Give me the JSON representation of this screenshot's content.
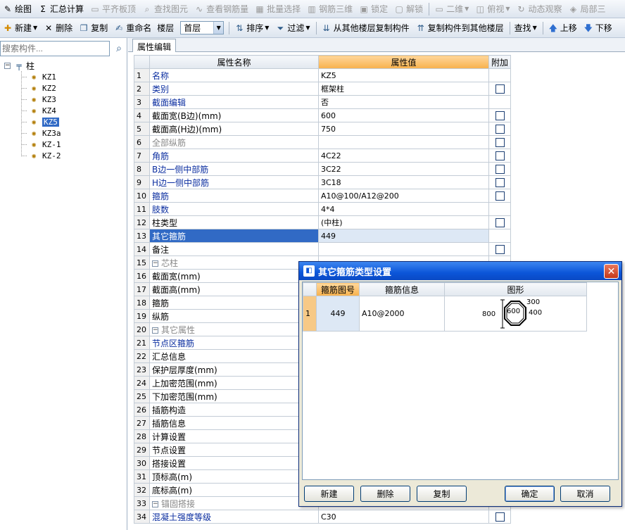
{
  "toolbar1": [
    {
      "label": "绘图",
      "icon": "draw-icon",
      "glyph": "✎",
      "disabled": false
    },
    {
      "label": "汇总计算",
      "icon": "sigma-icon",
      "glyph": "Σ",
      "disabled": false
    },
    {
      "label": "平齐板顶",
      "icon": "align-slab-top-icon",
      "glyph": "▭",
      "disabled": true
    },
    {
      "label": "查找图元",
      "icon": "find-element-icon",
      "glyph": "⌕",
      "disabled": true
    },
    {
      "label": "查看钢筋量",
      "icon": "view-rebar-icon",
      "glyph": "∿",
      "disabled": true
    },
    {
      "label": "批量选择",
      "icon": "batch-select-icon",
      "glyph": "▦",
      "disabled": true
    },
    {
      "label": "钢筋三维",
      "icon": "rebar-3d-icon",
      "glyph": "▥",
      "disabled": true
    },
    {
      "label": "锁定",
      "icon": "lock-icon",
      "glyph": "▣",
      "disabled": true
    },
    {
      "label": "解锁",
      "icon": "unlock-icon",
      "glyph": "▢",
      "disabled": true
    },
    {
      "label": "二维",
      "icon": "2d-view-icon",
      "glyph": "▭",
      "disabled": true
    },
    {
      "label": "俯视",
      "icon": "top-view-icon",
      "glyph": "◫",
      "disabled": true
    },
    {
      "label": "动态观察",
      "icon": "orbit-icon",
      "glyph": "↻",
      "disabled": true
    },
    {
      "label": "局部三",
      "icon": "local-3d-icon",
      "glyph": "◈",
      "disabled": true
    }
  ],
  "toolbar2": {
    "new": "新建",
    "delete": "删除",
    "copy": "复制",
    "rename": "重命名",
    "floor_label": "楼层",
    "floor_value": "首层",
    "sort": "排序",
    "filter": "过滤",
    "copy_from": "从其他楼层复制构件",
    "copy_to": "复制构件到其他楼层",
    "find": "查找",
    "move_up": "上移",
    "move_down": "下移"
  },
  "sidebar": {
    "search_placeholder": "搜索构件...",
    "root": "柱",
    "items": [
      "KZ1",
      "KZ2",
      "KZ3",
      "KZ4",
      "KZ5",
      "KZ3a",
      "KZ-1",
      "KZ-2"
    ],
    "selected_index": 4
  },
  "main": {
    "tab": "属性编辑",
    "headers": {
      "name": "属性名称",
      "value": "属性值",
      "extra": "附加"
    },
    "rows": [
      {
        "n": "1",
        "name": "名称",
        "value": "KZ5",
        "style": "blue",
        "cb": false,
        "indent": 0
      },
      {
        "n": "2",
        "name": "类别",
        "value": "框架柱",
        "style": "blue",
        "cb": true,
        "indent": 0
      },
      {
        "n": "3",
        "name": "截面编辑",
        "value": "否",
        "style": "blue",
        "cb": false,
        "indent": 0
      },
      {
        "n": "4",
        "name": "截面宽(B边)(mm)",
        "value": "600",
        "style": "",
        "cb": true,
        "indent": 0
      },
      {
        "n": "5",
        "name": "截面高(H边)(mm)",
        "value": "750",
        "style": "",
        "cb": true,
        "indent": 0
      },
      {
        "n": "6",
        "name": "全部纵筋",
        "value": "",
        "style": "gray",
        "cb": true,
        "indent": 0
      },
      {
        "n": "7",
        "name": "角筋",
        "value": "4C22",
        "style": "blue",
        "cb": true,
        "indent": 0
      },
      {
        "n": "8",
        "name": "B边一侧中部筋",
        "value": "3C22",
        "style": "blue",
        "cb": true,
        "indent": 0
      },
      {
        "n": "9",
        "name": "H边一侧中部筋",
        "value": "3C18",
        "style": "blue",
        "cb": true,
        "indent": 0
      },
      {
        "n": "10",
        "name": "箍筋",
        "value": "A10@100/A12@200",
        "style": "blue",
        "cb": true,
        "indent": 0
      },
      {
        "n": "11",
        "name": "肢数",
        "value": "4*4",
        "style": "blue",
        "cb": false,
        "indent": 0
      },
      {
        "n": "12",
        "name": "柱类型",
        "value": "(中柱)",
        "style": "",
        "cb": true,
        "indent": 0
      },
      {
        "n": "13",
        "name": "其它箍筋",
        "value": "449",
        "style": "",
        "cb": false,
        "indent": 0,
        "selected": true
      },
      {
        "n": "14",
        "name": "备注",
        "value": "",
        "style": "",
        "cb": true,
        "indent": 0
      },
      {
        "n": "15",
        "name": "芯柱",
        "value": "",
        "style": "gray",
        "cb": false,
        "indent": 0,
        "group": "−"
      },
      {
        "n": "16",
        "name": "截面宽(mm)",
        "value": "",
        "style": "",
        "cb": false,
        "indent": 1
      },
      {
        "n": "17",
        "name": "截面高(mm)",
        "value": "",
        "style": "",
        "cb": false,
        "indent": 1
      },
      {
        "n": "18",
        "name": "箍筋",
        "value": "",
        "style": "",
        "cb": false,
        "indent": 1
      },
      {
        "n": "19",
        "name": "纵筋",
        "value": "",
        "style": "",
        "cb": false,
        "indent": 1
      },
      {
        "n": "20",
        "name": "其它属性",
        "value": "",
        "style": "gray",
        "cb": false,
        "indent": 0,
        "group": "−"
      },
      {
        "n": "21",
        "name": "节点区箍筋",
        "value": "",
        "style": "blue",
        "cb": false,
        "indent": 1
      },
      {
        "n": "22",
        "name": "汇总信息",
        "value": "",
        "style": "",
        "cb": false,
        "indent": 1
      },
      {
        "n": "23",
        "name": "保护层厚度(mm)",
        "value": "",
        "style": "",
        "cb": false,
        "indent": 1
      },
      {
        "n": "24",
        "name": "上加密范围(mm)",
        "value": "",
        "style": "",
        "cb": false,
        "indent": 1
      },
      {
        "n": "25",
        "name": "下加密范围(mm)",
        "value": "",
        "style": "",
        "cb": false,
        "indent": 1
      },
      {
        "n": "26",
        "name": "插筋构造",
        "value": "",
        "style": "",
        "cb": false,
        "indent": 1
      },
      {
        "n": "27",
        "name": "插筋信息",
        "value": "",
        "style": "",
        "cb": false,
        "indent": 1
      },
      {
        "n": "28",
        "name": "计算设置",
        "value": "",
        "style": "",
        "cb": false,
        "indent": 1
      },
      {
        "n": "29",
        "name": "节点设置",
        "value": "",
        "style": "",
        "cb": false,
        "indent": 1
      },
      {
        "n": "30",
        "name": "搭接设置",
        "value": "",
        "style": "",
        "cb": false,
        "indent": 1
      },
      {
        "n": "31",
        "name": "顶标高(m)",
        "value": "",
        "style": "",
        "cb": false,
        "indent": 1
      },
      {
        "n": "32",
        "name": "底标高(m)",
        "value": "",
        "style": "",
        "cb": false,
        "indent": 1
      },
      {
        "n": "33",
        "name": "锚固搭接",
        "value": "",
        "style": "gray",
        "cb": false,
        "indent": 0,
        "group": "−"
      },
      {
        "n": "34",
        "name": "混凝土强度等级",
        "value": "C30",
        "style": "blue",
        "cb": true,
        "indent": 1
      }
    ]
  },
  "dialog": {
    "title": "其它箍筋类型设置",
    "headers": {
      "num": "",
      "code": "箍筋图号",
      "info": "箍筋信息",
      "shape": "图形"
    },
    "rows": [
      {
        "n": "1",
        "code": "449",
        "info": "A10@2000",
        "dim_center": "600",
        "dim_left": "800",
        "dim_top": "300",
        "dim_right": "400"
      }
    ],
    "buttons": {
      "new": "新建",
      "delete": "删除",
      "copy": "复制",
      "ok": "确定",
      "cancel": "取消"
    }
  }
}
